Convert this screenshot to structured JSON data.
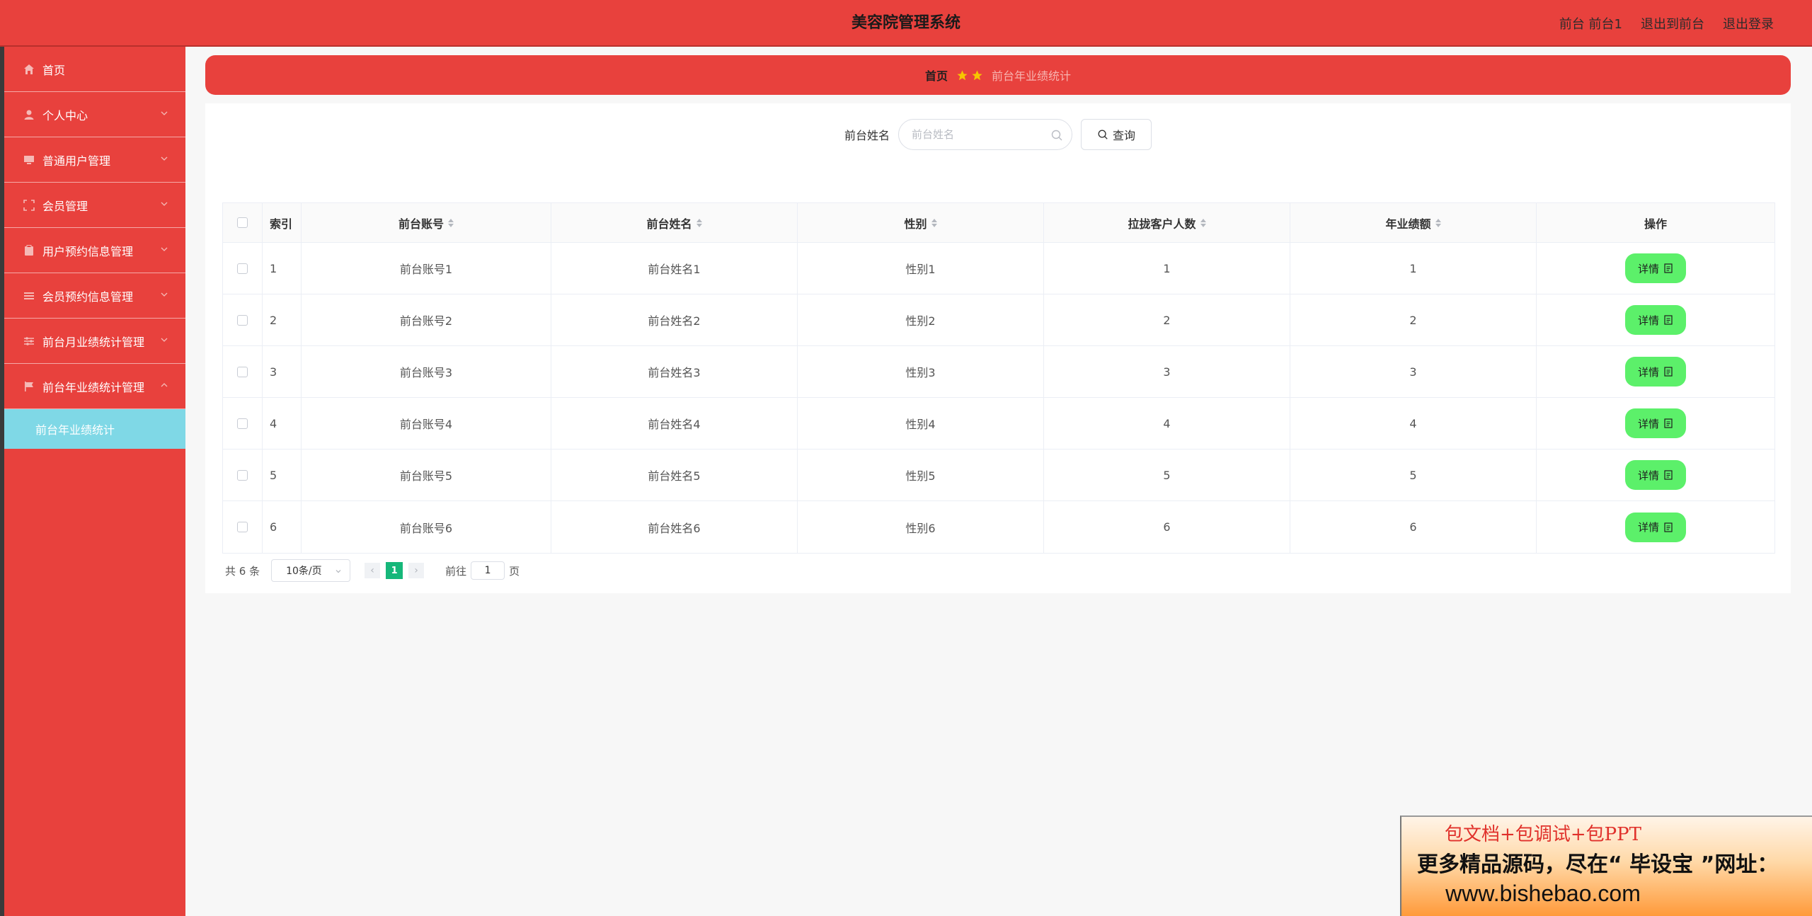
{
  "app": {
    "title": "美容院管理系统"
  },
  "header": {
    "user_label": "前台 前台1",
    "back_label": "退出到前台",
    "logout_label": "退出登录"
  },
  "sidebar": {
    "items": [
      {
        "label": "首页",
        "icon": "home-icon"
      },
      {
        "label": "个人中心",
        "icon": "user-icon"
      },
      {
        "label": "普通用户管理",
        "icon": "monitor-icon"
      },
      {
        "label": "会员管理",
        "icon": "crop-icon"
      },
      {
        "label": "用户预约信息管理",
        "icon": "clipboard-icon"
      },
      {
        "label": "会员预约信息管理",
        "icon": "list-icon"
      },
      {
        "label": "前台月业绩统计管理",
        "icon": "sliders-icon"
      },
      {
        "label": "前台年业绩统计管理",
        "icon": "flag-icon"
      }
    ],
    "active_sub": "前台年业绩统计"
  },
  "breadcrumb": {
    "home": "首页",
    "current": "前台年业绩统计"
  },
  "search": {
    "label": "前台姓名",
    "placeholder": "前台姓名",
    "button": "查询"
  },
  "table": {
    "columns": [
      "索引",
      "前台账号",
      "前台姓名",
      "性别",
      "拉拢客户人数",
      "年业绩额",
      "操作"
    ],
    "rows": [
      {
        "index": "1",
        "account": "前台账号1",
        "name": "前台姓名1",
        "gender": "性别1",
        "customers": "1",
        "amount": "1"
      },
      {
        "index": "2",
        "account": "前台账号2",
        "name": "前台姓名2",
        "gender": "性别2",
        "customers": "2",
        "amount": "2"
      },
      {
        "index": "3",
        "account": "前台账号3",
        "name": "前台姓名3",
        "gender": "性别3",
        "customers": "3",
        "amount": "3"
      },
      {
        "index": "4",
        "account": "前台账号4",
        "name": "前台姓名4",
        "gender": "性别4",
        "customers": "4",
        "amount": "4"
      },
      {
        "index": "5",
        "account": "前台账号5",
        "name": "前台姓名5",
        "gender": "性别5",
        "customers": "5",
        "amount": "5"
      },
      {
        "index": "6",
        "account": "前台账号6",
        "name": "前台姓名6",
        "gender": "性别6",
        "customers": "6",
        "amount": "6"
      }
    ],
    "detail_label": "详情"
  },
  "pagination": {
    "total": "共 6 条",
    "page_size": "10条/页",
    "current_page": "1",
    "goto_prefix": "前往",
    "goto_value": "1",
    "goto_suffix": "页"
  },
  "ad": {
    "line1": "包文档+包调试+包PPT",
    "line2": "更多精品源码，尽在“ 毕设宝 ”网址：",
    "line3": "www.bishebao.com"
  },
  "colors": {
    "primary": "#e8413d",
    "active_sub": "#7fd8e6",
    "detail_button": "#5cf06a",
    "page_active": "#16b77a"
  }
}
